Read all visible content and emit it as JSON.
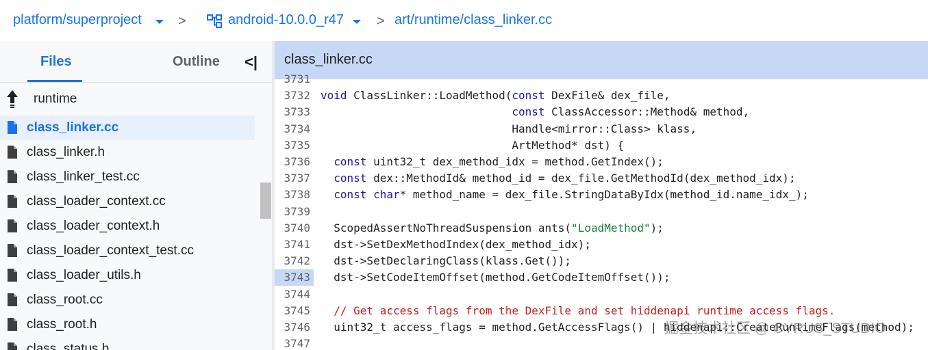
{
  "breadcrumb": {
    "project": "platform/superproject",
    "separator": ">",
    "branch": "android-10.0.0_r47",
    "path": "art/runtime/class_linker.cc"
  },
  "sidebar": {
    "tab_files": "Files",
    "tab_outline": "Outline",
    "collapse_glyph": "<|",
    "up_label": "runtime",
    "items": [
      {
        "label": "class_linker.cc",
        "selected": true
      },
      {
        "label": "class_linker.h"
      },
      {
        "label": "class_linker_test.cc"
      },
      {
        "label": "class_loader_context.cc"
      },
      {
        "label": "class_loader_context.h"
      },
      {
        "label": "class_loader_context_test.cc"
      },
      {
        "label": "class_loader_utils.h"
      },
      {
        "label": "class_root.cc"
      },
      {
        "label": "class_root.h"
      },
      {
        "label": "class_status.h"
      }
    ]
  },
  "editor": {
    "file_name": "class_linker.cc",
    "highlighted_line": "3743",
    "lines": [
      {
        "n": "3731",
        "t": ""
      },
      {
        "n": "3732",
        "t": "void ClassLinker::LoadMethod(const DexFile& dex_file,"
      },
      {
        "n": "3733",
        "t": "                             const ClassAccessor::Method& method,"
      },
      {
        "n": "3734",
        "t": "                             Handle<mirror::Class> klass,"
      },
      {
        "n": "3735",
        "t": "                             ArtMethod* dst) {"
      },
      {
        "n": "3736",
        "t": "  const uint32_t dex_method_idx = method.GetIndex();"
      },
      {
        "n": "3737",
        "t": "  const dex::MethodId& method_id = dex_file.GetMethodId(dex_method_idx);"
      },
      {
        "n": "3738",
        "t": "  const char* method_name = dex_file.StringDataByIdx(method_id.name_idx_);"
      },
      {
        "n": "3739",
        "t": ""
      },
      {
        "n": "3740",
        "t": "  ScopedAssertNoThreadSuspension ants(\"LoadMethod\");"
      },
      {
        "n": "3741",
        "t": "  dst->SetDexMethodIndex(dex_method_idx);"
      },
      {
        "n": "3742",
        "t": "  dst->SetDeclaringClass(klass.Get());"
      },
      {
        "n": "3743",
        "t": "  dst->SetCodeItemOffset(method.GetCodeItemOffset());"
      },
      {
        "n": "3744",
        "t": ""
      },
      {
        "n": "3745",
        "t": "  // Get access flags from the DexFile and set hiddenapi runtime access flags."
      },
      {
        "n": "3746",
        "t": "  uint32_t access_flags = method.GetAccessFlags() | hiddenapi::CreateRuntimeFlags(method);"
      },
      {
        "n": "3747",
        "t": ""
      }
    ]
  },
  "watermark": "掘金技术社区 @ CYRUS_STUDIO",
  "colors": {
    "accent": "#1a73e8",
    "header": "#c6d8f6",
    "keyword": "#1a1aa6",
    "string": "#188038",
    "comment": "#c5221f"
  }
}
